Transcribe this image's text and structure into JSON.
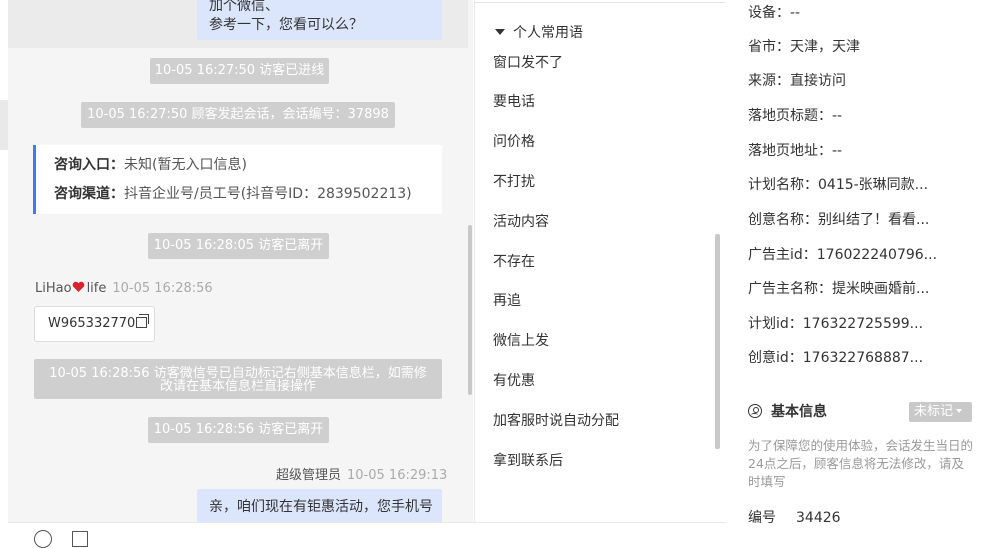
{
  "chat": {
    "top_bubble_line1": "加个微信、",
    "top_bubble_line2": "参考一下，您看可以么？",
    "sys1": "10-05 16:27:50 访客已进线",
    "sys2": "10-05 16:27:50 顾客发起会话，会话编号：37898",
    "card": {
      "entry_label": "咨询入口：",
      "entry_value": "未知(暂无入口信息)",
      "channel_label": "咨询渠道：",
      "channel_value": "抖音企业号/员工号(抖音号ID：2839502213)"
    },
    "sys3": "10-05 16:28:05 访客已离开",
    "visitor_name_a": "LiHao",
    "visitor_name_b": "life",
    "visitor_time": "10-05 16:28:56",
    "wechat_id": "W965332770",
    "sys4_line1": "10-05 16:28:56 访客微信号已自动标记右侧基本信息栏，如需修",
    "sys4_line2": "改请在基本信息栏直接操作",
    "sys5": "10-05 16:28:56 访客已离开",
    "agent_name": "超级管理员",
    "agent_time": "10-05 16:29:13",
    "agent_msg_line1": "亲，咱们现在有钜惠活动，您手机号"
  },
  "phrases": {
    "group_title": "个人常用语",
    "items": [
      "窗口发不了",
      "要电话",
      "问价格",
      "不打扰",
      "活动内容",
      "不存在",
      "再追",
      "微信上发",
      "有优惠",
      "加客服时说自动分配",
      "拿到联系后"
    ]
  },
  "info": {
    "device": "设备：--",
    "region": "省市：天津，天津",
    "source": "来源：直接访问",
    "landing_title": "落地页标题：--",
    "landing_url": "落地页地址：--",
    "plan_name": "计划名称：0415-张琳同款...",
    "creative_name": "创意名称：别纠结了！看看...",
    "advertiser_id": "广告主id：176022240796...",
    "advertiser_name": "广告主名称：提米映画婚前...",
    "plan_id": "计划id：176322725599...",
    "creative_id": "创意id：176322768887...",
    "basic_title": "基本信息",
    "tag_label": "未标记",
    "notice": "为了保障您的使用体验，会话发生当日的24点之后，顾客信息将无法修改，请及时填写",
    "serial_label": "编号",
    "serial_value": "34426"
  },
  "colors": {
    "accent": "#3d7bf0",
    "bubble": "#dbe6fc",
    "system": "#cfcfcf",
    "heart": "#d9242f"
  }
}
